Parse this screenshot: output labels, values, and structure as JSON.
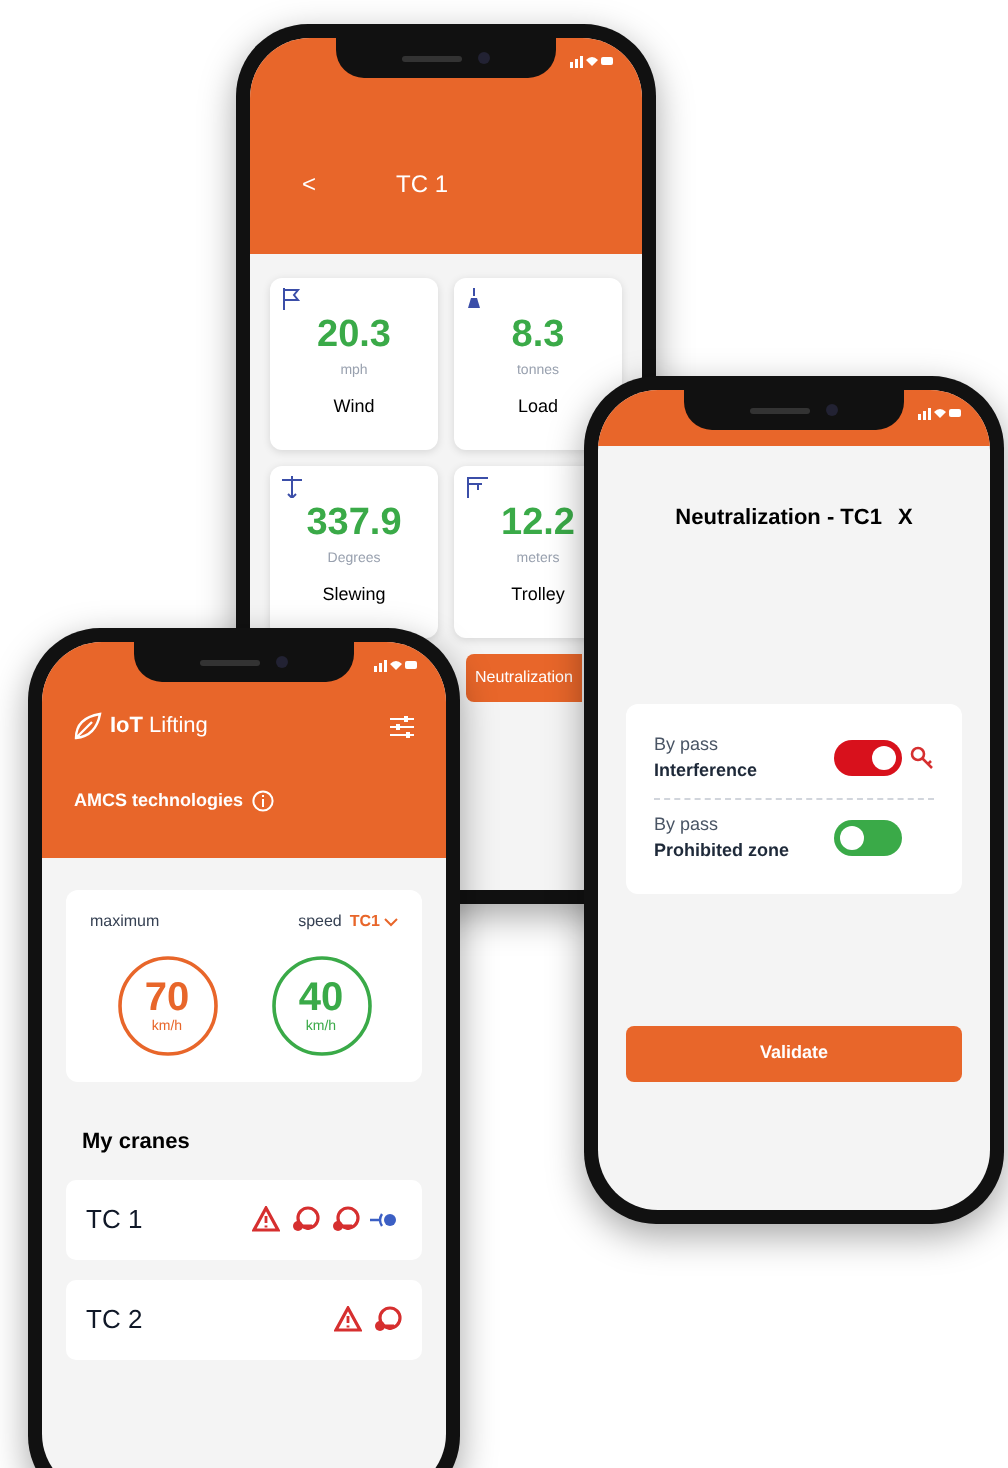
{
  "crane_detail_phone": {
    "back": "<",
    "title": "TC 1",
    "metrics": [
      {
        "kind": "wind",
        "value": "20.3",
        "unit": "mph",
        "label": "Wind"
      },
      {
        "kind": "load",
        "value": "8.3",
        "unit": "tonnes",
        "label": "Load"
      },
      {
        "kind": "slewing",
        "value": "337.9",
        "unit": "Degrees",
        "label": "Slewing"
      },
      {
        "kind": "trolley",
        "value": "12.2",
        "unit": "meters",
        "label": "Trolley"
      }
    ],
    "action_button": "Neutralization"
  },
  "neutralization_phone": {
    "title": "Neutralization - TC1",
    "close": "X",
    "bypasses": [
      {
        "caption": "By pass",
        "label": "Interference",
        "on": true,
        "key": true
      },
      {
        "caption": "By pass",
        "label": "Prohibited zone",
        "on": false,
        "key": false
      }
    ],
    "validate_button": "Validate"
  },
  "home_phone": {
    "logo": "**IoT** Lifting",
    "company": "AMCS technologies",
    "speed_card": {
      "left_label": "maximum",
      "right_label": "speed",
      "crane": "TC1",
      "gauges": [
        {
          "value": "70",
          "unit": "km/h",
          "color": "#e8662a"
        },
        {
          "value": "40",
          "unit": "km/h",
          "color": "#3aaa48"
        }
      ]
    },
    "section_title": "My cranes",
    "cranes": [
      {
        "name": "TC 1",
        "alerts": [
          {
            "kind": "warning"
          },
          {
            "kind": "key-alert"
          },
          {
            "kind": "key-alert"
          },
          {
            "kind": "signal"
          }
        ]
      },
      {
        "name": "TC 2",
        "alerts": [
          {
            "kind": "warning"
          },
          {
            "kind": "key-alert"
          }
        ]
      }
    ]
  }
}
